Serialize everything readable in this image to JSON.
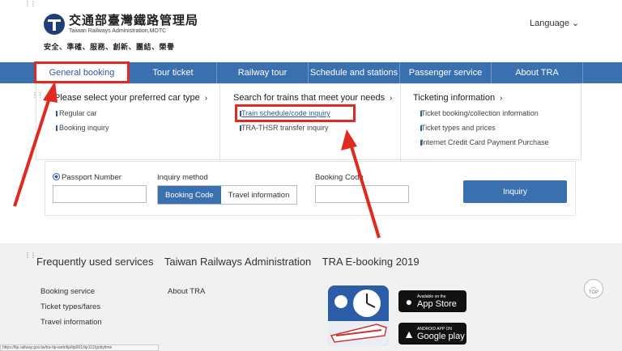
{
  "header": {
    "logo_cn": "交通部臺灣鐵路管理局",
    "logo_en": "Taiwan Railways Administration,MOTC",
    "slogan": "安全、準確、服務、創新、團結、榮譽",
    "language": "Language ⌄"
  },
  "nav": {
    "items": [
      {
        "label": "General booking"
      },
      {
        "label": "Tour ticket"
      },
      {
        "label": "Railway tour"
      },
      {
        "label": "Schedule and stations"
      },
      {
        "label": "Passenger service"
      },
      {
        "label": "About TRA"
      }
    ]
  },
  "dropdown": {
    "col1": {
      "title": "Please select your preferred car type",
      "links": [
        "Regular car",
        "Booking inquiry"
      ]
    },
    "col2": {
      "title": "Search for trains that meet your needs",
      "links": [
        "Train schedule/code inquiry",
        "TRA-THSR transfer inquiry"
      ]
    },
    "col3": {
      "title": "Ticketing information",
      "links": [
        "Ticket booking/collection information",
        "Ticket types and prices",
        "Internet Credit Card Payment Purchase"
      ]
    },
    "chevron": "›"
  },
  "form": {
    "passport_label": "Passport Number",
    "method_label": "Inquiry method",
    "method_options": [
      "Booking Code",
      "Travel information"
    ],
    "code_label": "Booking Code",
    "inquiry_button": "Inquiry"
  },
  "footer": {
    "titles": [
      "Frequently used services",
      "Taiwan Railways Administration",
      "TRA E-booking 2019"
    ],
    "links_col1": [
      "Booking service",
      "Ticket types/fares",
      "Travel information"
    ],
    "links_col2": [
      "About TRA"
    ],
    "app_store": {
      "small": "Available on the",
      "big": "App Store"
    },
    "google_play": {
      "small": "ANDROID APP ON",
      "big": "Google play"
    },
    "top_label": "TOP"
  },
  "status_bar": {
    "url": "https://tip.railway.gov.tw/tra-tip-web/tip/tip001/tip112/gobytime"
  },
  "colors": {
    "brand": "#3a6fb0",
    "highlight": "#e02a1f",
    "footer_bg": "#f1f1f1"
  }
}
